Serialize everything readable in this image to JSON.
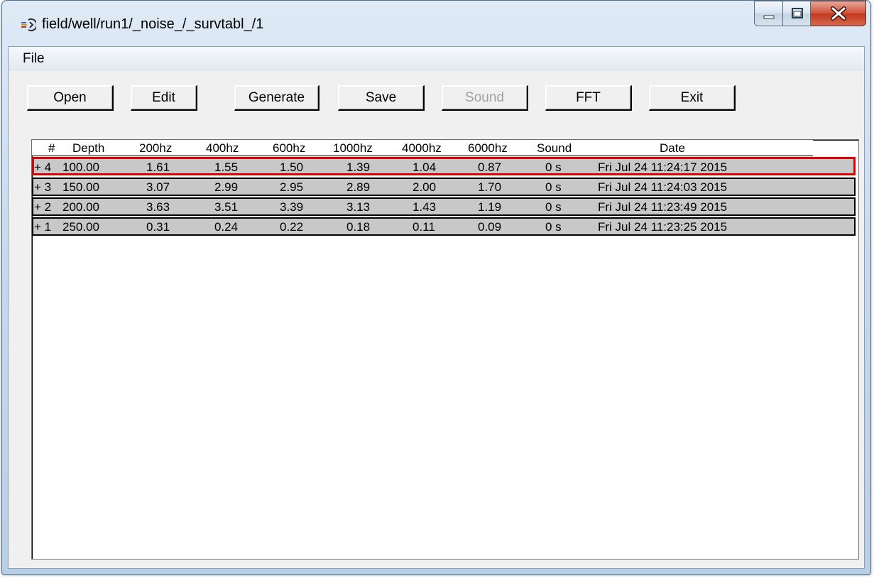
{
  "window": {
    "title": "field/well/run1/_noise_/_survtabl_/1"
  },
  "menu": {
    "file_label": "File"
  },
  "toolbar": {
    "open_label": "Open",
    "edit_label": "Edit",
    "generate_label": "Generate",
    "save_label": "Save",
    "sound_label": "Sound",
    "fft_label": "FFT",
    "exit_label": "Exit"
  },
  "table": {
    "columns": [
      "#",
      "Depth",
      "200hz",
      "400hz",
      "600hz",
      "1000hz",
      "4000hz",
      "6000hz",
      "Sound",
      "Date"
    ],
    "rows": [
      {
        "num": "+ 4",
        "depth": "100.00",
        "hz200": "1.61",
        "hz400": "1.55",
        "hz600": "1.50",
        "hz1000": "1.39",
        "hz4000": "1.04",
        "hz6000": "0.87",
        "sound": "0 s",
        "date": "Fri Jul 24 11:24:17 2015",
        "selected": true
      },
      {
        "num": "+ 3",
        "depth": "150.00",
        "hz200": "3.07",
        "hz400": "2.99",
        "hz600": "2.95",
        "hz1000": "2.89",
        "hz4000": "2.00",
        "hz6000": "1.70",
        "sound": "0 s",
        "date": "Fri Jul 24 11:24:03 2015",
        "selected": false
      },
      {
        "num": "+ 2",
        "depth": "200.00",
        "hz200": "3.63",
        "hz400": "3.51",
        "hz600": "3.39",
        "hz1000": "3.13",
        "hz4000": "1.43",
        "hz6000": "1.19",
        "sound": "0 s",
        "date": "Fri Jul 24 11:23:49 2015",
        "selected": false
      },
      {
        "num": "+ 1",
        "depth": "250.00",
        "hz200": "0.31",
        "hz400": "0.24",
        "hz600": "0.22",
        "hz1000": "0.18",
        "hz4000": "0.11",
        "hz6000": "0.09",
        "sound": "0 s",
        "date": "Fri Jul 24 11:23:25 2015",
        "selected": false
      }
    ]
  },
  "colors": {
    "selected_border": "#e00000",
    "row_background": "#c8c8c8"
  }
}
